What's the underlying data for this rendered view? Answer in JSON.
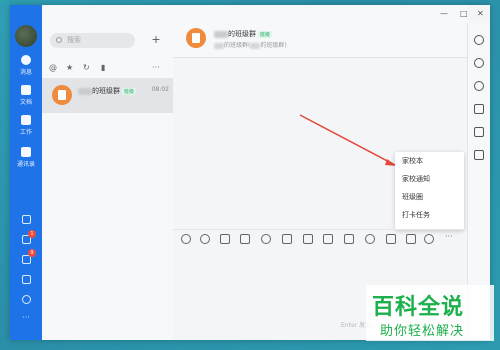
{
  "window": {
    "controls": [
      "—",
      "□",
      "✕"
    ]
  },
  "rail": {
    "items": [
      {
        "label": "消息",
        "icon": "message-icon"
      },
      {
        "label": "文档",
        "icon": "document-icon"
      },
      {
        "label": "工作",
        "icon": "workbench-icon"
      },
      {
        "label": "通讯录",
        "icon": "contacts-icon"
      }
    ],
    "bottom_icons": [
      "calendar-icon",
      "todo-icon",
      "rocket-icon",
      "mail-icon",
      "settings-icon",
      "more-icon"
    ],
    "badges": [
      "1",
      "9"
    ],
    "more": "···"
  },
  "convlist": {
    "search_placeholder": "搜索",
    "plus": "+",
    "filters": [
      "@",
      "★",
      "↻",
      "▮",
      "···"
    ],
    "items": [
      {
        "name_suffix": "的班级群",
        "tag": "班级",
        "time": "08:02"
      }
    ]
  },
  "chat": {
    "title_suffix": "的班级群",
    "tag": "班级",
    "subtitle_prefix": "",
    "subtitle_middle": "的班级群(",
    "subtitle_suffix": "的班级群)",
    "popup_items": [
      "家校本",
      "家校通知",
      "班级圈",
      "打卡任务"
    ],
    "toolbar_more": "···",
    "send_hint": "Enter 发送，C"
  },
  "watermark": {
    "title": "百科全说",
    "subtitle": "助你轻松解决"
  },
  "colors": {
    "accent": "#1e73e8",
    "arrow": "#e5483e",
    "avatar": "#f08a3c",
    "tag_green": "#2aa86b"
  }
}
